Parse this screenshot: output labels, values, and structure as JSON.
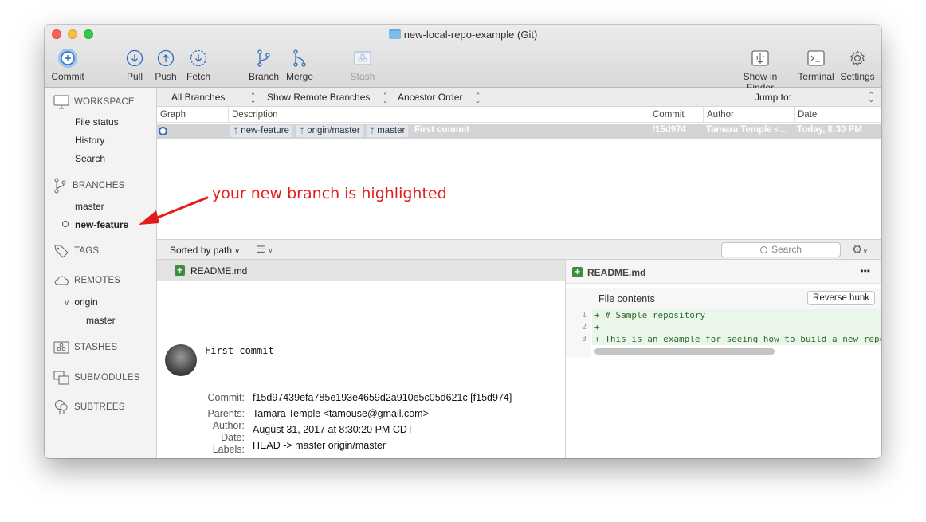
{
  "window": {
    "title": "new-local-repo-example (Git)"
  },
  "toolbar": {
    "commit": "Commit",
    "pull": "Pull",
    "push": "Push",
    "fetch": "Fetch",
    "branch": "Branch",
    "merge": "Merge",
    "stash": "Stash",
    "show_in_finder": "Show in Finder",
    "terminal": "Terminal",
    "settings": "Settings"
  },
  "sidebar": {
    "workspace": "WORKSPACE",
    "workspace_items": [
      "File status",
      "History",
      "Search"
    ],
    "branches": "BRANCHES",
    "branch_items": [
      "master",
      "new-feature"
    ],
    "tags": "TAGS",
    "remotes": "REMOTES",
    "remote_name": "origin",
    "remote_branch": "master",
    "stashes": "STASHES",
    "submodules": "SUBMODULES",
    "subtrees": "SUBTREES"
  },
  "filters": {
    "branches": "All Branches",
    "remote": "Show Remote Branches",
    "order": "Ancestor Order",
    "jump": "Jump to:"
  },
  "columns": {
    "graph": "Graph",
    "description": "Description",
    "commit": "Commit",
    "author": "Author",
    "date": "Date"
  },
  "commit_row": {
    "refs": [
      "new-feature",
      "origin/master",
      "master"
    ],
    "message": "First commit",
    "hash": "f15d974",
    "author": "Tamara Temple <...",
    "date": "Today, 8:30 PM"
  },
  "midbar": {
    "sort": "Sorted by path",
    "search_placeholder": "Search"
  },
  "files": [
    "README.md"
  ],
  "details": {
    "message": "First commit",
    "commit_label": "Commit:",
    "commit_value": "f15d97439efa785e193e4659d2a910e5c05d621c [f15d974]",
    "parents_label": "Parents:",
    "parents_value": "Tamara Temple <tamouse@gmail.com>",
    "author_label": "Author:",
    "date_label": "Date:",
    "date_value": "August 31, 2017 at 8:30:20 PM CDT",
    "labels_label": "Labels:",
    "labels_value": "HEAD -> master origin/master"
  },
  "diff": {
    "file": "README.md",
    "more": "•••",
    "hunk_title": "File contents",
    "reverse_button": "Reverse hunk",
    "lines": [
      {
        "num": "1",
        "text": "+ # Sample repository"
      },
      {
        "num": "2",
        "text": "+"
      },
      {
        "num": "3",
        "text": "+ This is an example for seeing how to build a new repo with"
      }
    ]
  },
  "annotation": {
    "text": "your new branch is highlighted",
    "color": "#e21c1c"
  },
  "colors": {
    "accent": "#2d6cc0",
    "selected_row": "#d4d4d4",
    "added_green": "#3d8f3d",
    "annotation_red": "#e21c1c"
  }
}
